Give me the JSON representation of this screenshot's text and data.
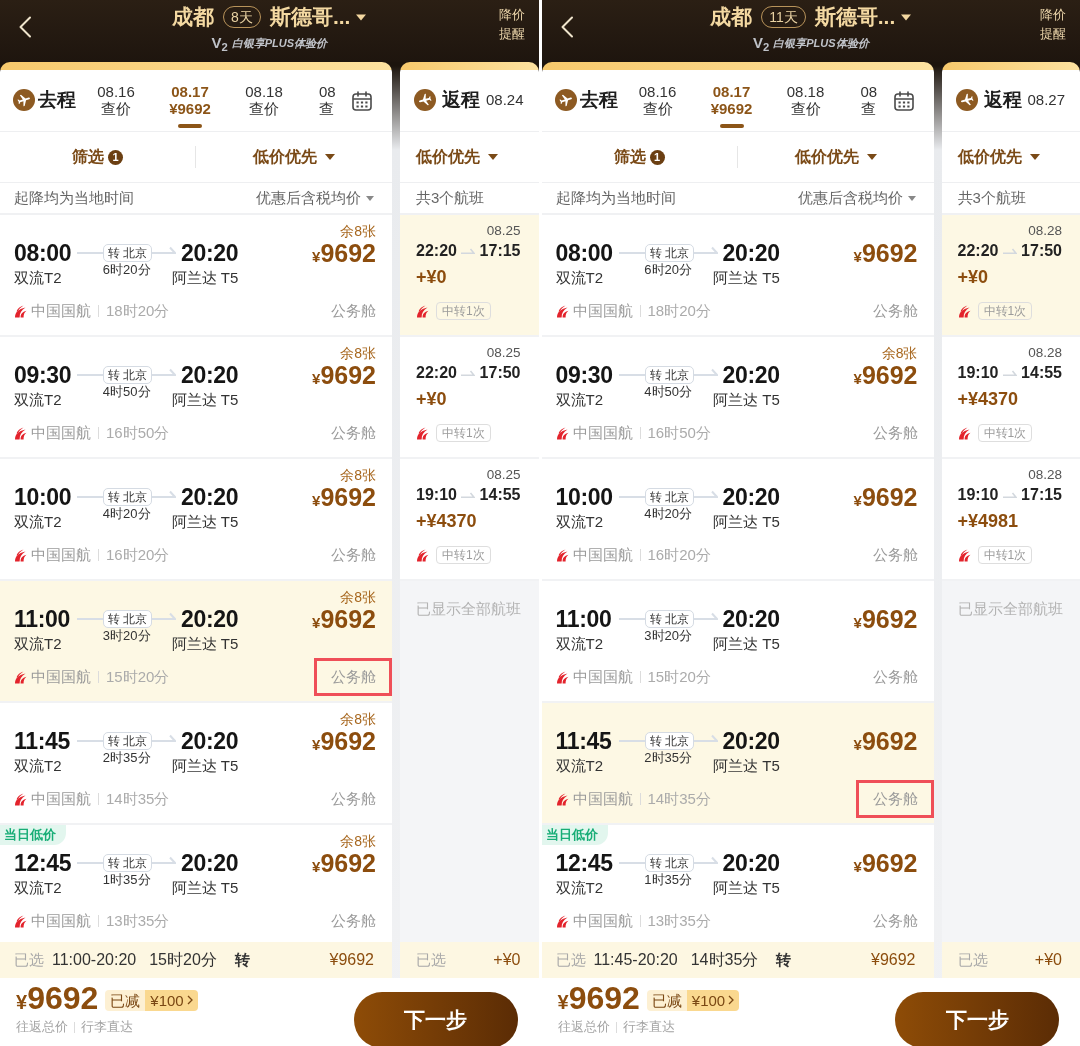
{
  "screens": [
    {
      "header": {
        "origin": "成都",
        "days": "8天",
        "destination": "斯德哥...",
        "member_level": "V$_{2}$",
        "subtitle": "白银享PLUS体验价",
        "price_alert": "降价提醒"
      },
      "outbound": {
        "label": "去程",
        "dates": [
          {
            "date": "08.16",
            "price": "查价",
            "selected": false
          },
          {
            "date": "08.17",
            "price": "¥9692",
            "selected": true
          },
          {
            "date": "08.18",
            "price": "查价",
            "selected": false
          },
          {
            "date": "08",
            "price": "查",
            "selected": false
          }
        ],
        "filter": {
          "label": "筛选",
          "count": "1"
        },
        "sort": "低价优先",
        "time_note": "起降均为当地时间",
        "price_note": "优惠后含税均价",
        "flights": [
          {
            "depart": "08:00",
            "depart_airport": "双流T2",
            "stopover": "转 北京",
            "layover": "6时20分",
            "arrive": "20:20",
            "arrive_airport": "阿兰达 T5",
            "seats": "余8张",
            "price": "¥9692",
            "airline": "中国国航",
            "duration": "18时20分",
            "cabin": "公务舱",
            "selected": false,
            "cabin_marked": false
          },
          {
            "depart": "09:30",
            "depart_airport": "双流T2",
            "stopover": "转 北京",
            "layover": "4时50分",
            "arrive": "20:20",
            "arrive_airport": "阿兰达 T5",
            "seats": "余8张",
            "price": "¥9692",
            "airline": "中国国航",
            "duration": "16时50分",
            "cabin": "公务舱",
            "selected": false,
            "cabin_marked": false
          },
          {
            "depart": "10:00",
            "depart_airport": "双流T2",
            "stopover": "转 北京",
            "layover": "4时20分",
            "arrive": "20:20",
            "arrive_airport": "阿兰达 T5",
            "seats": "余8张",
            "price": "¥9692",
            "airline": "中国国航",
            "duration": "16时20分",
            "cabin": "公务舱",
            "selected": false,
            "cabin_marked": false
          },
          {
            "depart": "11:00",
            "depart_airport": "双流T2",
            "stopover": "转 北京",
            "layover": "3时20分",
            "arrive": "20:20",
            "arrive_airport": "阿兰达 T5",
            "seats": "余8张",
            "price": "¥9692",
            "airline": "中国国航",
            "duration": "15时20分",
            "cabin": "公务舱",
            "selected": true,
            "cabin_marked": true
          },
          {
            "depart": "11:45",
            "depart_airport": "双流T2",
            "stopover": "转 北京",
            "layover": "2时35分",
            "arrive": "20:20",
            "arrive_airport": "阿兰达 T5",
            "seats": "余8张",
            "price": "¥9692",
            "airline": "中国国航",
            "duration": "14时35分",
            "cabin": "公务舱",
            "selected": false,
            "cabin_marked": false
          },
          {
            "tag": "当日低价",
            "depart": "12:45",
            "depart_airport": "双流T2",
            "stopover": "转 北京",
            "layover": "1时35分",
            "arrive": "20:20",
            "arrive_airport": "阿兰达 T5",
            "seats": "余8张",
            "price": "¥9692",
            "airline": "中国国航",
            "duration": "13时35分",
            "cabin": "公务舱",
            "selected": false,
            "cabin_marked": false
          }
        ]
      },
      "return": {
        "label": "返程",
        "date": "08.24",
        "sort": "低价优先",
        "count_note": "共3个航班",
        "flights": [
          {
            "date": "08.25",
            "depart": "22:20",
            "arrive": "17:15",
            "extra": "+¥0",
            "transfer": "中转1次",
            "selected": true
          },
          {
            "date": "08.25",
            "depart": "22:20",
            "arrive": "17:50",
            "extra": "+¥0",
            "transfer": "中转1次",
            "selected": false
          },
          {
            "date": "08.25",
            "depart": "19:10",
            "arrive": "14:55",
            "extra": "+¥4370",
            "transfer": "中转1次",
            "selected": false
          }
        ],
        "end_note": "已显示全部航班"
      },
      "selection": {
        "outbound": {
          "label": "已选",
          "times": "11:00-20:20",
          "duration": "15时20分",
          "stop": "转",
          "price": "¥9692"
        },
        "return": {
          "label": "已选",
          "price": "+¥0"
        }
      },
      "footer": {
        "total": "¥9692",
        "discount_label": "已减",
        "discount": "¥100",
        "total_label": "往返总价",
        "baggage_note": "行李直达",
        "next_button": "下一步"
      }
    },
    {
      "header": {
        "origin": "成都",
        "days": "11天",
        "destination": "斯德哥...",
        "member_level": "V$_{2}$",
        "subtitle": "白银享PLUS体验价",
        "price_alert": "降价提醒"
      },
      "outbound": {
        "label": "去程",
        "dates": [
          {
            "date": "08.16",
            "price": "查价",
            "selected": false
          },
          {
            "date": "08.17",
            "price": "¥9692",
            "selected": true
          },
          {
            "date": "08.18",
            "price": "查价",
            "selected": false
          },
          {
            "date": "08",
            "price": "查",
            "selected": false
          }
        ],
        "filter": {
          "label": "筛选",
          "count": "1"
        },
        "sort": "低价优先",
        "time_note": "起降均为当地时间",
        "price_note": "优惠后含税均价",
        "flights": [
          {
            "depart": "08:00",
            "depart_airport": "双流T2",
            "stopover": "转 北京",
            "layover": "6时20分",
            "arrive": "20:20",
            "arrive_airport": "阿兰达 T5",
            "price": "¥9692",
            "airline": "中国国航",
            "duration": "18时20分",
            "cabin": "公务舱",
            "selected": false,
            "cabin_marked": false
          },
          {
            "depart": "09:30",
            "depart_airport": "双流T2",
            "stopover": "转 北京",
            "layover": "4时50分",
            "arrive": "20:20",
            "arrive_airport": "阿兰达 T5",
            "seats": "余8张",
            "price": "¥9692",
            "airline": "中国国航",
            "duration": "16时50分",
            "cabin": "公务舱",
            "selected": false,
            "cabin_marked": false
          },
          {
            "depart": "10:00",
            "depart_airport": "双流T2",
            "stopover": "转 北京",
            "layover": "4时20分",
            "arrive": "20:20",
            "arrive_airport": "阿兰达 T5",
            "price": "¥9692",
            "airline": "中国国航",
            "duration": "16时20分",
            "cabin": "公务舱",
            "selected": false,
            "cabin_marked": false
          },
          {
            "depart": "11:00",
            "depart_airport": "双流T2",
            "stopover": "转 北京",
            "layover": "3时20分",
            "arrive": "20:20",
            "arrive_airport": "阿兰达 T5",
            "price": "¥9692",
            "airline": "中国国航",
            "duration": "15时20分",
            "cabin": "公务舱",
            "selected": false,
            "cabin_marked": false
          },
          {
            "depart": "11:45",
            "depart_airport": "双流T2",
            "stopover": "转 北京",
            "layover": "2时35分",
            "arrive": "20:20",
            "arrive_airport": "阿兰达 T5",
            "price": "¥9692",
            "airline": "中国国航",
            "duration": "14时35分",
            "cabin": "公务舱",
            "selected": true,
            "cabin_marked": true
          },
          {
            "tag": "当日低价",
            "depart": "12:45",
            "depart_airport": "双流T2",
            "stopover": "转 北京",
            "layover": "1时35分",
            "arrive": "20:20",
            "arrive_airport": "阿兰达 T5",
            "price": "¥9692",
            "airline": "中国国航",
            "duration": "13时35分",
            "cabin": "公务舱",
            "selected": false,
            "cabin_marked": false
          }
        ]
      },
      "return": {
        "label": "返程",
        "date": "08.27",
        "sort": "低价优先",
        "count_note": "共3个航班",
        "flights": [
          {
            "date": "08.28",
            "depart": "22:20",
            "arrive": "17:50",
            "extra": "+¥0",
            "transfer": "中转1次",
            "selected": true
          },
          {
            "date": "08.28",
            "depart": "19:10",
            "arrive": "14:55",
            "extra": "+¥4370",
            "transfer": "中转1次",
            "selected": false
          },
          {
            "date": "08.28",
            "depart": "19:10",
            "arrive": "17:15",
            "extra": "+¥4981",
            "transfer": "中转1次",
            "selected": false
          }
        ],
        "end_note": "已显示全部航班"
      },
      "selection": {
        "outbound": {
          "label": "已选",
          "times": "11:45-20:20",
          "duration": "14时35分",
          "stop": "转",
          "price": "¥9692"
        },
        "return": {
          "label": "已选",
          "price": "+¥0"
        }
      },
      "footer": {
        "total": "¥9692",
        "discount_label": "已减",
        "discount": "¥100",
        "total_label": "往返总价",
        "baggage_note": "行李直达",
        "next_button": "下一步"
      }
    }
  ]
}
